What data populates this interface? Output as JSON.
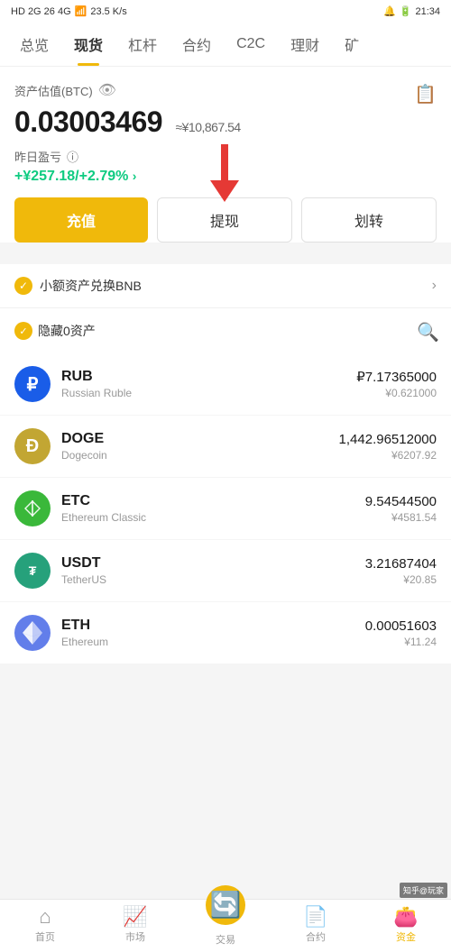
{
  "statusBar": {
    "left": "HD 2G 26 46",
    "signal": "wifi",
    "speed": "23.5 K/s",
    "time": "21:34",
    "battery": "20"
  },
  "nav": {
    "items": [
      {
        "label": "总览",
        "active": false
      },
      {
        "label": "现货",
        "active": true
      },
      {
        "label": "杠杆",
        "active": false
      },
      {
        "label": "合约",
        "active": false
      },
      {
        "label": "C2C",
        "active": false
      },
      {
        "label": "理财",
        "active": false
      },
      {
        "label": "矿",
        "active": false
      }
    ]
  },
  "portfolio": {
    "assetLabel": "资产估值(BTC)",
    "btcValue": "0.03003469",
    "cnyApprox": "≈¥10,867.54",
    "pnlLabel": "昨日盈亏",
    "pnlValue": "+¥257.18/+2.79%",
    "infoIcon": "ⓘ"
  },
  "buttons": {
    "deposit": "充值",
    "withdraw": "提现",
    "transfer": "划转"
  },
  "bnbBanner": {
    "text": "小额资产兑换BNB"
  },
  "assetsFilter": {
    "label": "隐藏0资产"
  },
  "assets": [
    {
      "symbol": "RUB",
      "name": "Russian Ruble",
      "iconType": "rub",
      "iconSymbol": "₽",
      "amountPrimary": "₽7.17365000",
      "amountCny": "¥0.621000"
    },
    {
      "symbol": "DOGE",
      "name": "Dogecoin",
      "iconType": "doge",
      "iconSymbol": "Ð",
      "amountPrimary": "1,442.96512000",
      "amountCny": "¥6207.92"
    },
    {
      "symbol": "ETC",
      "name": "Ethereum Classic",
      "iconType": "etc",
      "iconSymbol": "◆",
      "amountPrimary": "9.54544500",
      "amountCny": "¥4581.54"
    },
    {
      "symbol": "USDT",
      "name": "TetherUS",
      "iconType": "usdt",
      "iconSymbol": "₮",
      "amountPrimary": "3.21687404",
      "amountCny": "¥20.85"
    },
    {
      "symbol": "ETH",
      "name": "Ethereum",
      "iconType": "eth",
      "iconSymbol": "Ξ",
      "amountPrimary": "0.00051603",
      "amountCny": "¥11.24"
    }
  ],
  "bottomNav": [
    {
      "label": "首页",
      "icon": "⌂",
      "active": false
    },
    {
      "label": "市场",
      "icon": "📊",
      "active": false
    },
    {
      "label": "交易",
      "icon": "🔄",
      "active": false
    },
    {
      "label": "合约",
      "icon": "📄",
      "active": false
    },
    {
      "label": "资金",
      "icon": "👛",
      "active": true
    }
  ],
  "watermark": "知乎@玩家"
}
